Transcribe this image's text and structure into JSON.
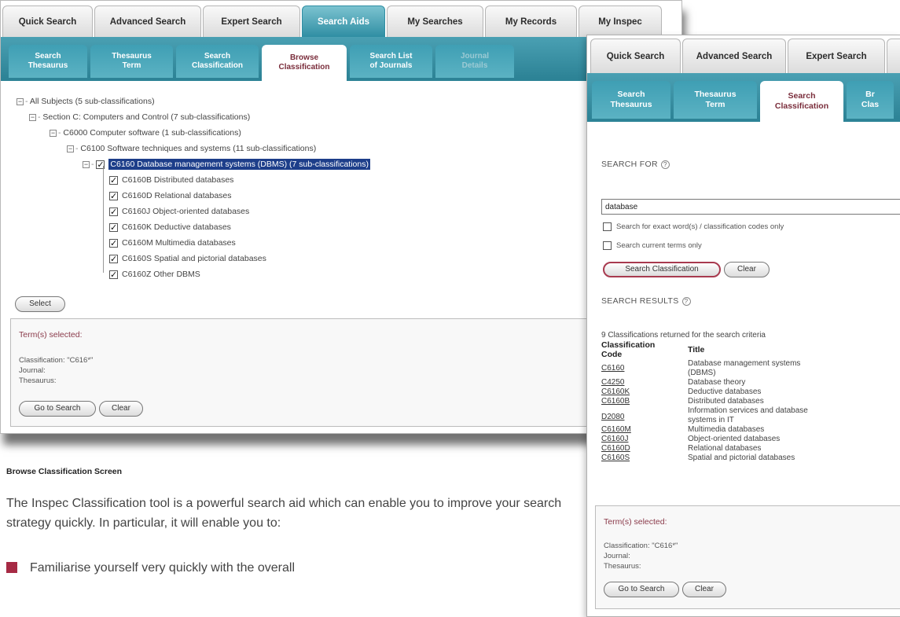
{
  "screen1": {
    "main_tabs": [
      {
        "label": "Quick Search",
        "active": false
      },
      {
        "label": "Advanced Search",
        "active": false
      },
      {
        "label": "Expert Search",
        "active": false
      },
      {
        "label": "Search Aids",
        "active": true
      },
      {
        "label": "My Searches",
        "active": false
      },
      {
        "label": "My Records",
        "active": false
      },
      {
        "label": "My Inspec",
        "active": false
      }
    ],
    "sub_tabs": [
      {
        "line1": "Search",
        "line2": "Thesaurus",
        "state": "normal"
      },
      {
        "line1": "Thesaurus",
        "line2": "Term",
        "state": "normal"
      },
      {
        "line1": "Search",
        "line2": "Classification",
        "state": "normal"
      },
      {
        "line1": "Browse",
        "line2": "Classification",
        "state": "active"
      },
      {
        "line1": "Search List",
        "line2": "of Journals",
        "state": "normal"
      },
      {
        "line1": "Journal",
        "line2": "Details",
        "state": "disabled"
      }
    ],
    "tree": [
      {
        "label": "All Subjects (5 sub-classifications)"
      },
      {
        "label": "Section C: Computers and Control (7 sub-classifications)"
      },
      {
        "label": "C6000 Computer software (1 sub-classifications)"
      },
      {
        "label": "C6100 Software techniques and systems (11 sub-classifications)"
      },
      {
        "label": "C6160 Database management systems (DBMS) (7 sub-classifications)"
      }
    ],
    "leaves": [
      "C6160B Distributed databases",
      "C6160D Relational databases",
      "C6160J Object-oriented databases",
      "C6160K Deductive databases",
      "C6160M Multimedia databases",
      "C6160S Spatial and pictorial databases",
      "C6160Z Other DBMS"
    ],
    "select_button": "Select",
    "terms": {
      "title": "Term(s) selected:",
      "classification": "Classification: \"C616*\"",
      "journal": "Journal:",
      "thesaurus": "Thesaurus:",
      "go_button": "Go to Search",
      "clear_button": "Clear"
    }
  },
  "caption": "Browse Classification Screen",
  "intro": "The Inspec Classification tool is a powerful search aid which can enable you to improve your search strategy quickly. In particular, it will enable you to:",
  "bullet": "Familiarise yourself very quickly with the overall",
  "colors": {
    "teal": "#2d8396",
    "maroon": "#a62a44",
    "highlight": "#1d3e8a"
  },
  "screen2": {
    "main_tabs": [
      "Quick Search",
      "Advanced Search",
      "Expert Search"
    ],
    "sub_tabs": [
      {
        "line1": "Search",
        "line2": "Thesaurus",
        "state": "normal"
      },
      {
        "line1": "Thesaurus",
        "line2": "Term",
        "state": "normal"
      },
      {
        "line1": "Search",
        "line2": "Classification",
        "state": "active"
      },
      {
        "line1": "Br",
        "line2": "Clas",
        "state": "normal"
      }
    ],
    "search_for_label": "SEARCH FOR",
    "search_value": "database",
    "exact_option": "Search for exact word(s) / classification codes only",
    "current_option": "Search current terms only",
    "search_button": "Search Classification",
    "clear_button": "Clear",
    "results_label": "SEARCH RESULTS",
    "results_count": "9 Classifications returned for the search criteria",
    "col_code": "Classification Code",
    "col_title": "Title",
    "results": [
      {
        "code": "C6160",
        "title": "Database management systems (DBMS)"
      },
      {
        "code": "C4250",
        "title": "Database theory"
      },
      {
        "code": "C6160K",
        "title": "Deductive databases"
      },
      {
        "code": "C6160B",
        "title": "Distributed databases"
      },
      {
        "code": "D2080",
        "title": "Information services and database systems in IT"
      },
      {
        "code": "C6160M",
        "title": "Multimedia databases"
      },
      {
        "code": "C6160J",
        "title": "Object-oriented databases"
      },
      {
        "code": "C6160D",
        "title": "Relational databases"
      },
      {
        "code": "C6160S",
        "title": "Spatial and pictorial databases"
      }
    ],
    "terms": {
      "title": "Term(s) selected:",
      "classification": "Classification: \"C616*\"",
      "journal": "Journal:",
      "thesaurus": "Thesaurus:",
      "go_button": "Go to Search",
      "clear_button": "Clear"
    }
  }
}
